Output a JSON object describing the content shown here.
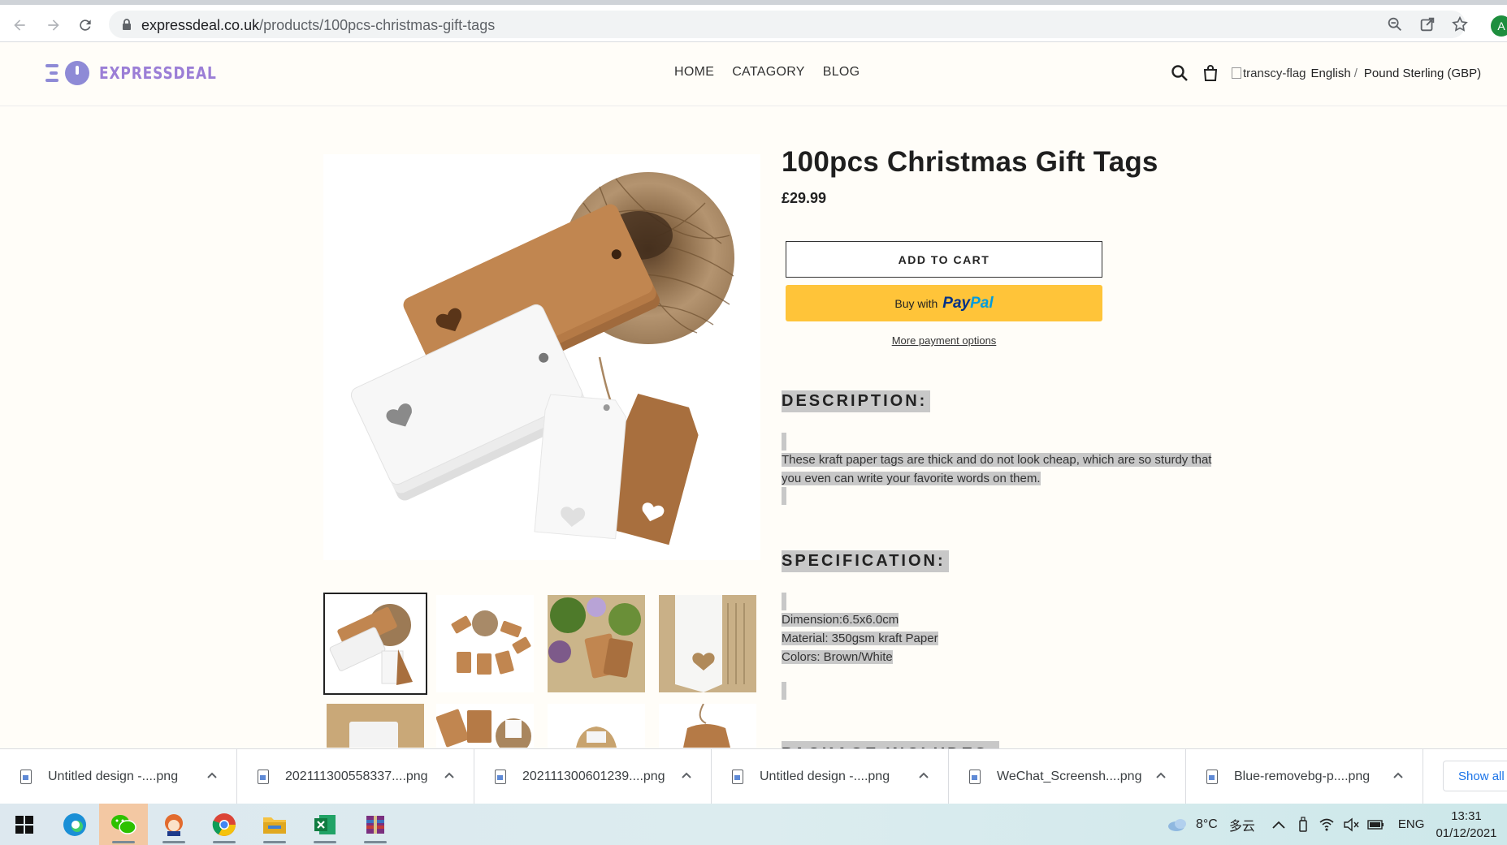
{
  "browser": {
    "url_host": "expressdeal.co.uk",
    "url_path": "/products/100pcs-christmas-gift-tags",
    "profile_initial": "A"
  },
  "site": {
    "logo_text": "EXPRESSDEAL",
    "nav": [
      "HOME",
      "CATAGORY",
      "BLOG"
    ],
    "flag_alt": "transcy-flag",
    "language": "English",
    "separator": "/",
    "currency": "Pound Sterling (GBP)"
  },
  "product": {
    "title": "100pcs Christmas Gift Tags",
    "price": "£29.99",
    "add_to_cart": "ADD TO CART",
    "paypal_prefix": "Buy with",
    "paypal_brand_1": "Pay",
    "paypal_brand_2": "Pal",
    "more_payment": "More payment options",
    "description_heading": "DESCRIPTION:",
    "description_line1": "These kraft paper tags are thick and do not look cheap, which are so sturdy that",
    "description_line2": "you even can write your favorite words on them.",
    "specification_heading": "SPECIFICATION:",
    "spec": [
      "Dimension:6.5x6.0cm",
      "Material: 350gsm kraft Paper",
      "Colors: Brown/White"
    ],
    "next_heading_partial": "PACKAGE INCLUDES:"
  },
  "downloads": {
    "items": [
      "Untitled design -....png",
      "202111300558337....png",
      "202111300601239....png",
      "Untitled design -....png",
      "WeChat_Screensh....png",
      "Blue-removebg-p....png"
    ],
    "show_all": "Show all"
  },
  "taskbar": {
    "weather_temp": "8°C",
    "weather_text": "多云",
    "input_lang": "ENG",
    "time": "13:31",
    "date": "01/12/2021"
  },
  "colors": {
    "accent_logo": "#9b7ed6",
    "paypal_yellow": "#ffc439",
    "selection_gray": "#c8c8c8"
  }
}
